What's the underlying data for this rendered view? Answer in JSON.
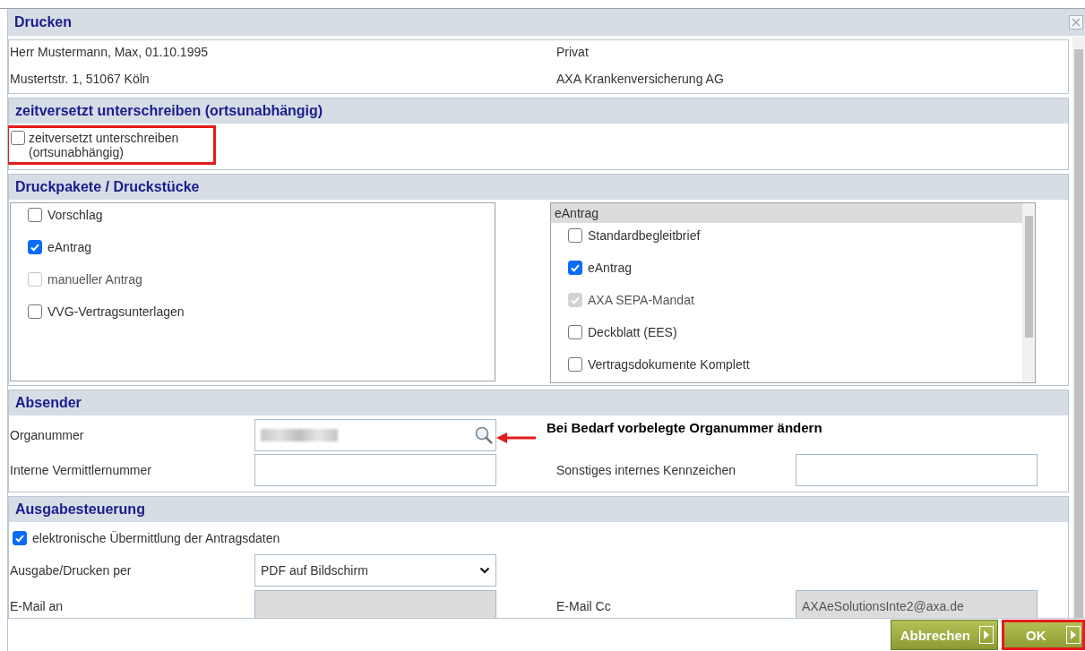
{
  "dialog": {
    "title": "Drucken"
  },
  "customer": {
    "left": [
      "Herr Mustermann, Max, 01.10.1995",
      "Mustertstr. 1, 51067 Köln"
    ],
    "right": [
      "Privat",
      "AXA Krankenversicherung AG"
    ]
  },
  "deferred": {
    "heading": "zeitversetzt unterschreiben (ortsunabhängig)",
    "option": {
      "label": "zeitversetzt unterschreiben (ortsunabhängig)",
      "checked": false,
      "disabled": false
    }
  },
  "packages": {
    "heading": "Druckpakete / Druckstücke",
    "items": [
      {
        "label": "Vorschlag",
        "checked": false,
        "disabled": false
      },
      {
        "label": "eAntrag",
        "checked": true,
        "disabled": false
      },
      {
        "label": "manueller Antrag",
        "checked": false,
        "disabled": true
      },
      {
        "label": "VVG-Vertragsunterlagen",
        "checked": false,
        "disabled": false
      }
    ],
    "documents": {
      "group": "eAntrag",
      "items": [
        {
          "label": "Standardbegleitbrief",
          "checked": false,
          "disabled": false
        },
        {
          "label": "eAntrag",
          "checked": true,
          "disabled": false
        },
        {
          "label": "AXA SEPA-Mandat",
          "checked": true,
          "disabled": true
        },
        {
          "label": "Deckblatt (EES)",
          "checked": false,
          "disabled": false
        },
        {
          "label": "Vertragsdokumente Komplett",
          "checked": false,
          "disabled": false
        }
      ]
    }
  },
  "sender": {
    "heading": "Absender",
    "fields": [
      {
        "kind": "search",
        "label": "Organummer",
        "redacted": true
      },
      {
        "kind": "text",
        "label": "Interne Vermittlernummer"
      },
      {
        "kind": "text",
        "label": "Sonstiges internes Kennzeichen"
      }
    ],
    "note": "Bei Bedarf vorbelegte Organummer ändern"
  },
  "output": {
    "heading": "Ausgabesteuerung",
    "option": {
      "label": "elektronische Übermittlung der Antragsdaten",
      "checked": true,
      "disabled": false
    },
    "fields": [
      {
        "kind": "select",
        "label": "Ausgabe/Drucken per",
        "value": "PDF auf Bildschirm"
      },
      {
        "kind": "text",
        "label": "E-Mail an",
        "disabled": true
      },
      {
        "kind": "text",
        "label": "E-Mail Cc",
        "disabled": true,
        "value": "AXAeSolutionsInte2@axa.de"
      }
    ]
  },
  "buttons": [
    {
      "label": "Abbrechen",
      "highlighted": false
    },
    {
      "label": "OK",
      "highlighted": true
    }
  ]
}
